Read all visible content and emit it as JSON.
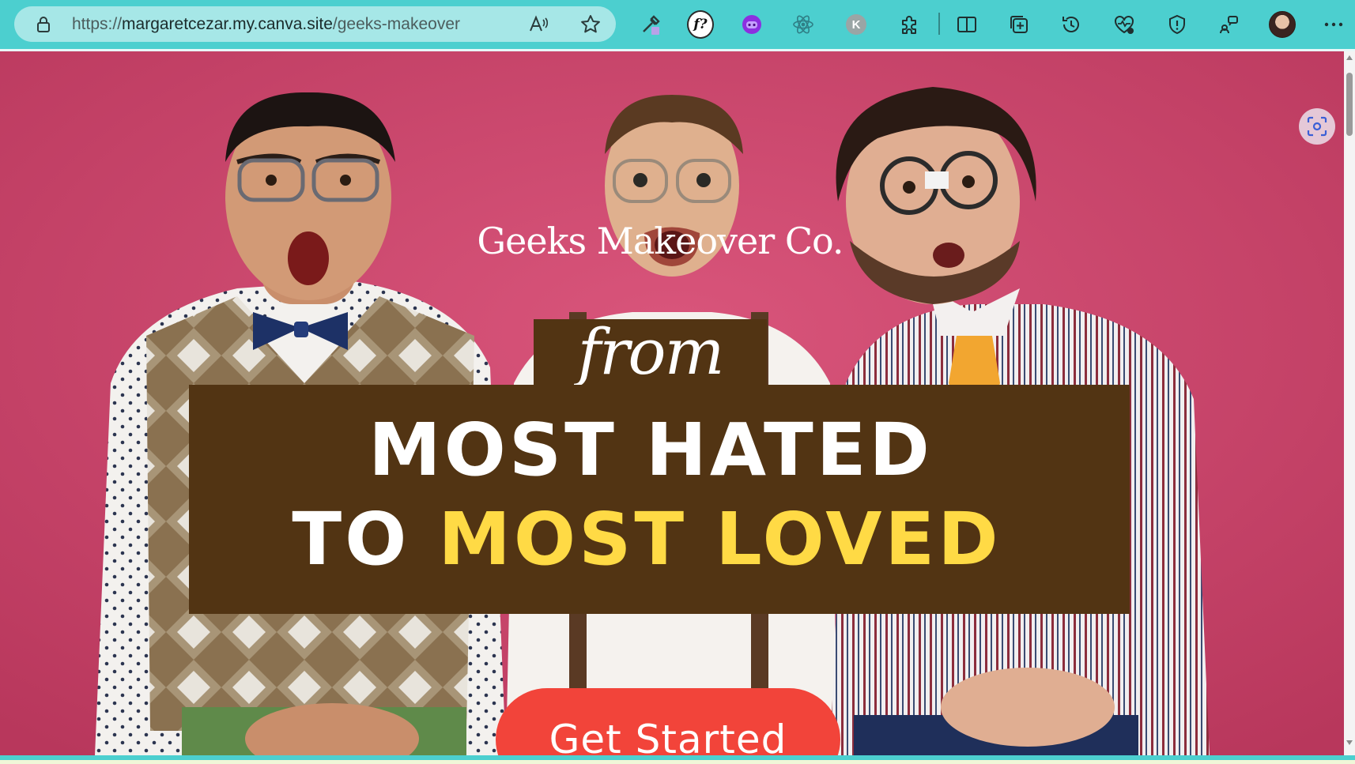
{
  "browser": {
    "url_prefix": "https://",
    "url_host": "margaretcezar.my.canva.site",
    "url_path": "/geeks-makeover",
    "extension_k_label": "K",
    "extension_fq_label": "f?",
    "toolbar_color": "#4ccfcf"
  },
  "hero": {
    "brand_name": "Geeks Makeover Co.",
    "from_word": "from",
    "headline_line1": "MOST HATED",
    "headline_line2_prefix": "TO ",
    "headline_line2_accent": "MOST LOVED",
    "cta_label": "Get Started",
    "colors": {
      "background": "#c94469",
      "banner": "#523413",
      "accent_text": "#ffda45",
      "cta": "#f2443a"
    }
  }
}
